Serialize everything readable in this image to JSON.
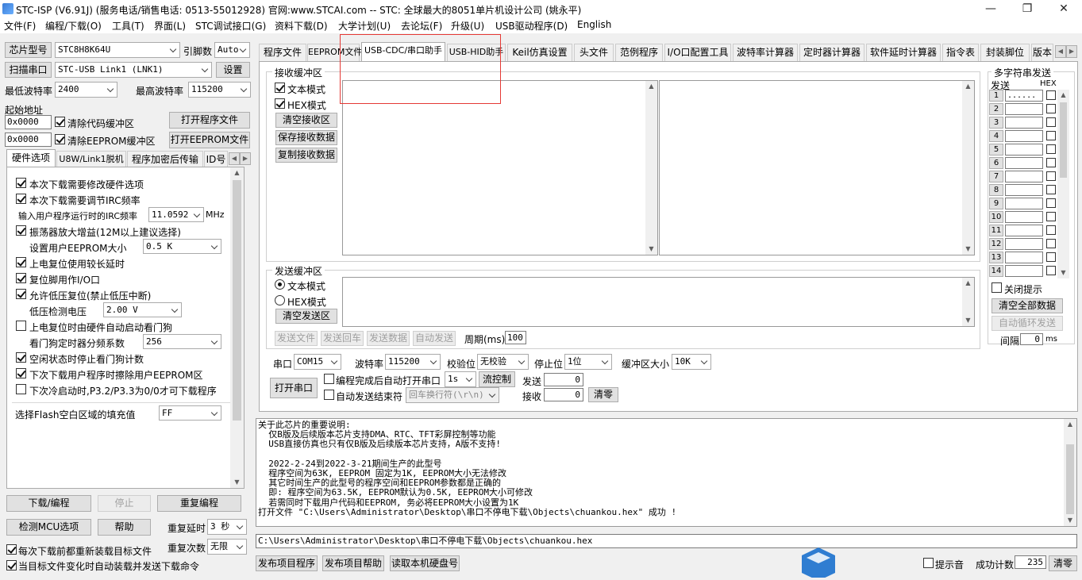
{
  "window": {
    "title": "STC-ISP (V6.91J) (服务电话/销售电话: 0513-55012928) 官网:www.STCAI.com  -- STC: 全球最大的8051单片机设计公司 (姚永平)",
    "min": "—",
    "max": "❐",
    "close": "✕"
  },
  "menu": [
    "文件(F)",
    "编程/下载(O)",
    "工具(T)",
    "界面(L)",
    "STC调试接口(G)",
    "资料下载(D)",
    "大学计划(U)",
    "去论坛(F)",
    "升级(U)",
    "USB驱动程序(D)",
    "English"
  ],
  "left": {
    "chip_btn": "芯片型号",
    "chip_value": "STC8H8K64U",
    "pin_label": "引脚数",
    "pin_value": "Auto",
    "scan_btn": "扫描串口",
    "port_value": "STC-USB Link1 (LNK1)",
    "settings_btn": "设置",
    "min_baud_label": "最低波特率",
    "min_baud_value": "2400",
    "max_baud_label": "最高波特率",
    "max_baud_value": "115200",
    "start_addr_label": "起始地址",
    "addr1": "0x0000",
    "clear_code_label": "清除代码缓冲区",
    "open_prog_btn": "打开程序文件",
    "addr2": "0x0000",
    "clear_eeprom_label": "清除EEPROM缓冲区",
    "open_eeprom_btn": "打开EEPROM文件",
    "tabs": [
      "硬件选项",
      "U8W/Link1脱机",
      "程序加密后传输",
      "ID号"
    ],
    "opts": {
      "o1": "本次下载需要修改硬件选项",
      "o2": "本次下载需要调节IRC频率",
      "irc_label": "输入用户程序运行时的IRC频率",
      "irc_value": "11.0592",
      "irc_unit": "MHz",
      "o3": "振荡器放大增益(12M以上建议选择)",
      "eeprom_size_label": "设置用户EEPROM大小",
      "eeprom_size_value": "0.5 K",
      "o4": "上电复位使用较长延时",
      "o5": "复位脚用作I/O口",
      "o6": "允许低压复位(禁止低压中断)",
      "lvd_label": "低压检测电压",
      "lvd_value": "2.00 V",
      "o7": "上电复位时由硬件自动启动看门狗",
      "wdt_label": "看门狗定时器分频系数",
      "wdt_value": "256",
      "o8": "空闲状态时停止看门狗计数",
      "o9": "下次下载用户程序时擦除用户EEPROM区",
      "o10": "下次冷启动时,P3.2/P3.3为0/0才可下载程序",
      "fill_label": "选择Flash空白区域的填充值",
      "fill_value": "FF"
    },
    "download_btn": "下载/编程",
    "stop_btn": "停止",
    "reprogram_btn": "重复编程",
    "detect_btn": "检测MCU选项",
    "help_btn": "帮助",
    "repeat_delay_label": "重复延时",
    "repeat_delay_value": "3 秒",
    "reload_label": "每次下载前都重新装载目标文件",
    "repeat_count_label": "重复次数",
    "repeat_count_value": "无限",
    "auto_reload_label": "当目标文件变化时自动装载并发送下载命令"
  },
  "tabs": [
    "程序文件",
    "EEPROM文件",
    "USB-CDC/串口助手",
    "USB-HID助手",
    "Keil仿真设置",
    "头文件",
    "范例程序",
    "I/O口配置工具",
    "波特率计算器",
    "定时器计算器",
    "软件延时计算器",
    "指令表",
    "封装脚位",
    "版本"
  ],
  "serial": {
    "recv_label": "接收缓冲区",
    "text_mode": "文本模式",
    "hex_mode": "HEX模式",
    "clear_recv": "清空接收区",
    "save_recv": "保存接收数据",
    "copy_recv": "复制接收数据",
    "send_label": "发送缓冲区",
    "send_text_mode": "文本模式",
    "send_hex_mode": "HEX模式",
    "clear_send": "清空发送区",
    "send_file": "发送文件",
    "send_cr": "发送回车",
    "send_data": "发送数据",
    "auto_send": "自动发送",
    "period_label": "周期(ms)",
    "period_value": "100",
    "port_label": "串口",
    "port_value": "COM15",
    "baud_label": "波特率",
    "baud_value": "115200",
    "parity_label": "校验位",
    "parity_value": "无校验",
    "stop_label": "停止位",
    "stop_value": "1位",
    "buf_label": "缓冲区大小",
    "buf_value": "10K",
    "open_btn": "打开串口",
    "auto_open_label": "编程完成后自动打开串口",
    "auto_open_value": "1s",
    "flow_btn": "流控制",
    "tx_label": "发送",
    "tx_value": "0",
    "auto_end_label": "自动发送结束符",
    "newline_value": "回车换行符(\\r\\n)",
    "rx_label": "接收",
    "rx_value": "0",
    "clear_btn": "清零"
  },
  "multi": {
    "title": "多字符串发送",
    "send_hdr": "发送",
    "hex_hdr": "HEX",
    "first_value": "......",
    "rows": [
      "1",
      "2",
      "3",
      "4",
      "5",
      "6",
      "7",
      "8",
      "9",
      "10",
      "11",
      "12",
      "13",
      "14"
    ],
    "close_tip": "关闭提示",
    "clear_all": "清空全部数据",
    "auto_loop": "自动循环发送",
    "interval_label": "间隔",
    "interval_value": "0",
    "interval_unit": "ms"
  },
  "log": {
    "lines": [
      "关于此芯片的重要说明:",
      "  仅B版及后续版本芯片支持DMA、RTC、TFT彩屏控制等功能",
      "  USB直接仿真也只有仅B版及后续版本芯片支持，A版不支持!",
      "",
      "  2022-2-24到2022-3-21期间生产的此型号",
      "  程序空间为63K, EEPROM 固定为1K, EEPROM大小无法修改",
      "  其它时间生产的此型号的程序空间和EEPROM参数都是正确的",
      "  即: 程序空间为63.5K, EEPROM默认为0.5K, EEPROM大小可修改",
      "  若需同时下载用户代码和EEPROM, 务必将EEPROM大小设置为1K",
      "打开文件 \"C:\\Users\\Administrator\\Desktop\\串口不停电下载\\Objects\\chuankou.hex\" 成功 !"
    ]
  },
  "path": "C:\\Users\\Administrator\\Desktop\\串口不停电下载\\Objects\\chuankou.hex",
  "bottom": {
    "publish_prog": "发布项目程序",
    "publish_help": "发布项目帮助",
    "read_hd": "读取本机硬盘号",
    "beep_label": "提示音",
    "success_label": "成功计数",
    "success_value": "235",
    "clear_btn": "清零"
  },
  "colors": {
    "highlight_box": "#e53935",
    "accent": "#0078d7"
  }
}
